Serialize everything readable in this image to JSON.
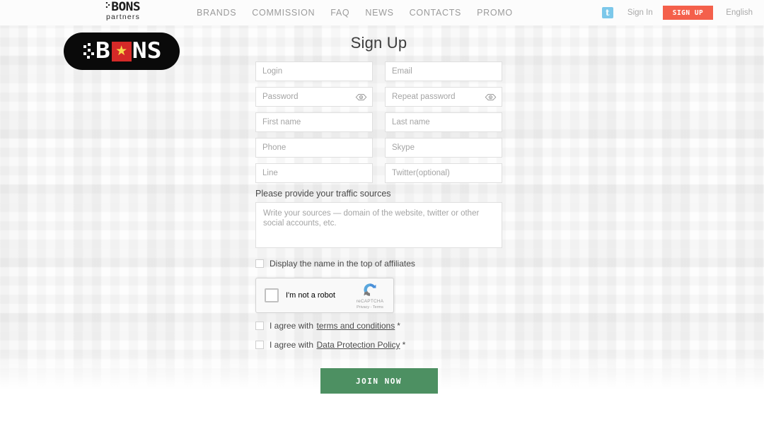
{
  "header": {
    "brand_main": "BONS",
    "brand_sub": "partners",
    "nav": [
      {
        "label": "BRANDS"
      },
      {
        "label": "COMMISSION"
      },
      {
        "label": "FAQ"
      },
      {
        "label": "NEWS"
      },
      {
        "label": "CONTACTS"
      },
      {
        "label": "PROMO"
      }
    ],
    "twitter_glyph": "t",
    "sign_in": "Sign In",
    "sign_up": "SIGN UP",
    "language": "English",
    "signup_color": "#f4604b"
  },
  "logo": {
    "letters_left": "B",
    "letters_right": "NS",
    "star": "★",
    "flag_color": "#d42a28",
    "star_color": "#f7d94c"
  },
  "form": {
    "title": "Sign Up",
    "fields": [
      {
        "name": "login",
        "placeholder": "Login",
        "value": ""
      },
      {
        "name": "email",
        "placeholder": "Email",
        "value": ""
      },
      {
        "name": "password",
        "placeholder": "Password",
        "value": ""
      },
      {
        "name": "repeat_password",
        "placeholder": "Repeat password",
        "value": ""
      },
      {
        "name": "first_name",
        "placeholder": "First name",
        "value": ""
      },
      {
        "name": "last_name",
        "placeholder": "Last name",
        "value": ""
      },
      {
        "name": "phone",
        "placeholder": "Phone",
        "value": ""
      },
      {
        "name": "skype",
        "placeholder": "Skype",
        "value": ""
      },
      {
        "name": "line",
        "placeholder": "Line",
        "value": ""
      },
      {
        "name": "twitter",
        "placeholder": "Twitter(optional)",
        "value": ""
      }
    ],
    "traffic_label": "Please provide your traffic sources",
    "traffic_placeholder": "Write your sources — domain of the website, twitter or other social accounts, etc.",
    "traffic_value": "",
    "display_name_label": "Display the name in the top of affiliates",
    "recaptcha": {
      "label": "I'm not a robot",
      "brand": "reCAPTCHA",
      "links": "Privacy - Terms"
    },
    "agreements": [
      {
        "prefix": "I agree with",
        "link": "terms and conditions",
        "required": "*"
      },
      {
        "prefix": "I agree with",
        "link": "Data Protection Policy",
        "required": "*"
      }
    ],
    "submit_label": "JOIN NOW",
    "submit_color": "#4d9062",
    "link_color": "#e8796e"
  }
}
